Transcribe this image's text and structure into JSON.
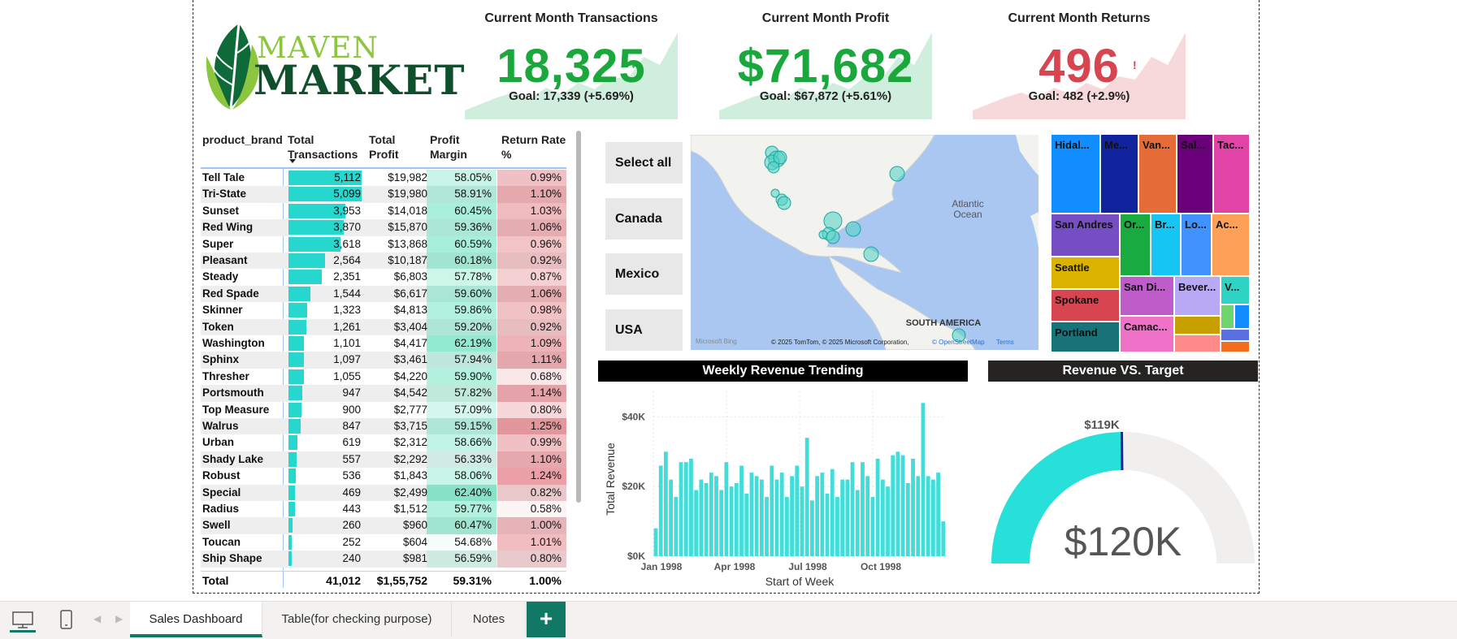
{
  "kpis": [
    {
      "title": "Current Month Transactions",
      "value": "18,325",
      "goal": "Goal: 17,339 (+5.69%)",
      "status": "✓",
      "color": "#1aa83c",
      "spark": "#cfeedd"
    },
    {
      "title": "Current Month Profit",
      "value": "$71,682",
      "goal": "Goal: $67,872 (+5.61%)",
      "status": "✓",
      "color": "#1aa83c",
      "spark": "#cfeedd"
    },
    {
      "title": "Current Month Returns",
      "value": "496",
      "goal": "Goal: 482 (+2.9%)",
      "status": "!",
      "color": "#d64550",
      "spark": "#f8d9db"
    }
  ],
  "logo": {
    "line1": "MAVEN",
    "line2": "MARKET"
  },
  "table": {
    "headers": {
      "brand": "product_brand",
      "trans": "Total Transactions",
      "profit": "Total Profit",
      "margin": "Profit Margin",
      "return": "Return Rate %"
    },
    "rows": [
      {
        "brand": "Tell Tale",
        "trans": "5,112",
        "profit": "$19,982",
        "margin": "58.05%",
        "ret": "0.99%",
        "t": 5112,
        "m": 58.05,
        "r": 0.99
      },
      {
        "brand": "Tri-State",
        "trans": "5,099",
        "profit": "$19,980",
        "margin": "58.91%",
        "ret": "1.10%",
        "t": 5099,
        "m": 58.91,
        "r": 1.1
      },
      {
        "brand": "Sunset",
        "trans": "3,953",
        "profit": "$14,018",
        "margin": "60.45%",
        "ret": "1.03%",
        "t": 3953,
        "m": 60.45,
        "r": 1.03
      },
      {
        "brand": "Red Wing",
        "trans": "3,870",
        "profit": "$15,870",
        "margin": "59.36%",
        "ret": "1.06%",
        "t": 3870,
        "m": 59.36,
        "r": 1.06
      },
      {
        "brand": "Super",
        "trans": "3,618",
        "profit": "$13,868",
        "margin": "60.59%",
        "ret": "0.96%",
        "t": 3618,
        "m": 60.59,
        "r": 0.96
      },
      {
        "brand": "Pleasant",
        "trans": "2,564",
        "profit": "$10,187",
        "margin": "60.18%",
        "ret": "0.92%",
        "t": 2564,
        "m": 60.18,
        "r": 0.92
      },
      {
        "brand": "Steady",
        "trans": "2,351",
        "profit": "$6,803",
        "margin": "57.78%",
        "ret": "0.87%",
        "t": 2351,
        "m": 57.78,
        "r": 0.87
      },
      {
        "brand": "Red Spade",
        "trans": "1,544",
        "profit": "$6,617",
        "margin": "59.60%",
        "ret": "1.06%",
        "t": 1544,
        "m": 59.6,
        "r": 1.06
      },
      {
        "brand": "Skinner",
        "trans": "1,323",
        "profit": "$4,813",
        "margin": "59.86%",
        "ret": "0.98%",
        "t": 1323,
        "m": 59.86,
        "r": 0.98
      },
      {
        "brand": "Token",
        "trans": "1,261",
        "profit": "$3,404",
        "margin": "59.20%",
        "ret": "0.92%",
        "t": 1261,
        "m": 59.2,
        "r": 0.92
      },
      {
        "brand": "Washington",
        "trans": "1,101",
        "profit": "$4,417",
        "margin": "62.19%",
        "ret": "1.09%",
        "t": 1101,
        "m": 62.19,
        "r": 1.09
      },
      {
        "brand": "Sphinx",
        "trans": "1,097",
        "profit": "$3,461",
        "margin": "57.94%",
        "ret": "1.11%",
        "t": 1097,
        "m": 57.94,
        "r": 1.11
      },
      {
        "brand": "Thresher",
        "trans": "1,055",
        "profit": "$4,220",
        "margin": "59.90%",
        "ret": "0.68%",
        "t": 1055,
        "m": 59.9,
        "r": 0.68
      },
      {
        "brand": "Portsmouth",
        "trans": "947",
        "profit": "$4,542",
        "margin": "57.82%",
        "ret": "1.14%",
        "t": 947,
        "m": 57.82,
        "r": 1.14
      },
      {
        "brand": "Top Measure",
        "trans": "900",
        "profit": "$2,777",
        "margin": "57.09%",
        "ret": "0.80%",
        "t": 900,
        "m": 57.09,
        "r": 0.8
      },
      {
        "brand": "Walrus",
        "trans": "847",
        "profit": "$3,715",
        "margin": "59.15%",
        "ret": "1.25%",
        "t": 847,
        "m": 59.15,
        "r": 1.25
      },
      {
        "brand": "Urban",
        "trans": "619",
        "profit": "$2,312",
        "margin": "58.66%",
        "ret": "0.99%",
        "t": 619,
        "m": 58.66,
        "r": 0.99
      },
      {
        "brand": "Shady Lake",
        "trans": "557",
        "profit": "$2,292",
        "margin": "56.33%",
        "ret": "1.10%",
        "t": 557,
        "m": 56.33,
        "r": 1.1
      },
      {
        "brand": "Robust",
        "trans": "536",
        "profit": "$1,843",
        "margin": "58.06%",
        "ret": "1.24%",
        "t": 536,
        "m": 58.06,
        "r": 1.24
      },
      {
        "brand": "Special",
        "trans": "469",
        "profit": "$2,499",
        "margin": "62.40%",
        "ret": "0.82%",
        "t": 469,
        "m": 62.4,
        "r": 0.82
      },
      {
        "brand": "Radius",
        "trans": "443",
        "profit": "$1,512",
        "margin": "59.77%",
        "ret": "0.58%",
        "t": 443,
        "m": 59.77,
        "r": 0.58
      },
      {
        "brand": "Swell",
        "trans": "260",
        "profit": "$960",
        "margin": "60.47%",
        "ret": "1.00%",
        "t": 260,
        "m": 60.47,
        "r": 1.0
      },
      {
        "brand": "Toucan",
        "trans": "252",
        "profit": "$604",
        "margin": "54.68%",
        "ret": "1.01%",
        "t": 252,
        "m": 54.68,
        "r": 1.01
      },
      {
        "brand": "Ship Shape",
        "trans": "240",
        "profit": "$981",
        "margin": "56.59%",
        "ret": "0.80%",
        "t": 240,
        "m": 56.59,
        "r": 0.8
      }
    ],
    "total": {
      "label": "Total",
      "trans": "41,012",
      "profit": "$1,55,752",
      "margin": "59.31%",
      "ret": "1.00%"
    }
  },
  "slicer": [
    "Select all",
    "Canada",
    "Mexico",
    "USA"
  ],
  "map": {
    "labels": {
      "atlantic": "Atlantic Ocean",
      "south_america": "SOUTH AMERICA",
      "bing": "Microsoft Bing",
      "copyright": "© 2025 TomTom, © 2025 Microsoft Corporation,",
      "osm": "© OpenStreetMap",
      "terms": "Terms"
    },
    "colors": {
      "water": "#a9c7f0",
      "land": "#f2f2ee",
      "bubble": "#4fd1c5"
    }
  },
  "treemap": [
    {
      "label": "Hidal...",
      "color": "#118DFF"
    },
    {
      "label": "Me...",
      "color": "#12239E"
    },
    {
      "label": "Van...",
      "color": "#E66C37"
    },
    {
      "label": "Sal...",
      "color": "#6B007B"
    },
    {
      "label": "Tac...",
      "color": "#E044A7"
    },
    {
      "label": "San Andres",
      "color": "#744EC2"
    },
    {
      "label": "Or...",
      "color": "#1AAB40"
    },
    {
      "label": "Br...",
      "color": "#15C6F4"
    },
    {
      "label": "Lo...",
      "color": "#4092FF"
    },
    {
      "label": "Ac...",
      "color": "#FFA058"
    },
    {
      "label": "Seattle",
      "color": "#D9B300"
    },
    {
      "label": "Spokane",
      "color": "#D64550"
    },
    {
      "label": "Portland",
      "color": "#197278"
    },
    {
      "label": "San Di...",
      "color": "#BE5DC9"
    },
    {
      "label": "Bever...",
      "color": "#B8A9F5"
    },
    {
      "label": "V...",
      "color": "#2ED3C4"
    },
    {
      "label": "Camac...",
      "color": "#EE72C7"
    },
    {
      "label": "",
      "color": "#C7A000"
    },
    {
      "label": "",
      "color": "#FF8A8A"
    },
    {
      "label": "",
      "color": "#6ED46E"
    },
    {
      "label": "",
      "color": "#118DFF"
    },
    {
      "label": "",
      "color": "#5A6FE0"
    },
    {
      "label": "",
      "color": "#F56E1E"
    }
  ],
  "weekly": {
    "title": "Weekly Revenue Trending",
    "ylabel": "Total Revenue",
    "xlabel": "Start of Week",
    "yticks": [
      "$40K",
      "$20K",
      "$0K"
    ],
    "xticks": [
      "Jan 1998",
      "Apr 1998",
      "Jul 1998",
      "Oct 1998"
    ]
  },
  "gauge": {
    "title": "Revenue VS. Target",
    "target_label": "$119K",
    "value_label": "$120K",
    "fill_color": "#26e0d9",
    "track_color": "#f0efed",
    "target_color": "#12239E"
  },
  "chart_data": {
    "type": "bar",
    "title": "Weekly Revenue Trending",
    "xlabel": "Start of Week",
    "ylabel": "Total Revenue",
    "ylim": [
      0,
      45000
    ],
    "x_range": [
      "Jan 1998",
      "Dec 1998"
    ],
    "values": [
      8000,
      26000,
      30000,
      22000,
      17000,
      27000,
      27000,
      28000,
      19000,
      22000,
      21000,
      24000,
      23000,
      19000,
      27000,
      20000,
      21000,
      26000,
      18000,
      24000,
      23000,
      22000,
      17000,
      26000,
      22000,
      24000,
      17000,
      23000,
      26000,
      20000,
      34000,
      16000,
      23000,
      24000,
      18000,
      25000,
      17000,
      22000,
      22000,
      27000,
      19000,
      27000,
      23000,
      17000,
      28000,
      22000,
      20000,
      29000,
      30000,
      29000,
      21000,
      28000,
      23000,
      44000,
      23000,
      22000,
      24000,
      10000
    ]
  },
  "bottombar": {
    "tabs": [
      "Sales Dashboard",
      "Table(for checking purpose)",
      "Notes"
    ],
    "add": "+",
    "accent": "#117865"
  }
}
